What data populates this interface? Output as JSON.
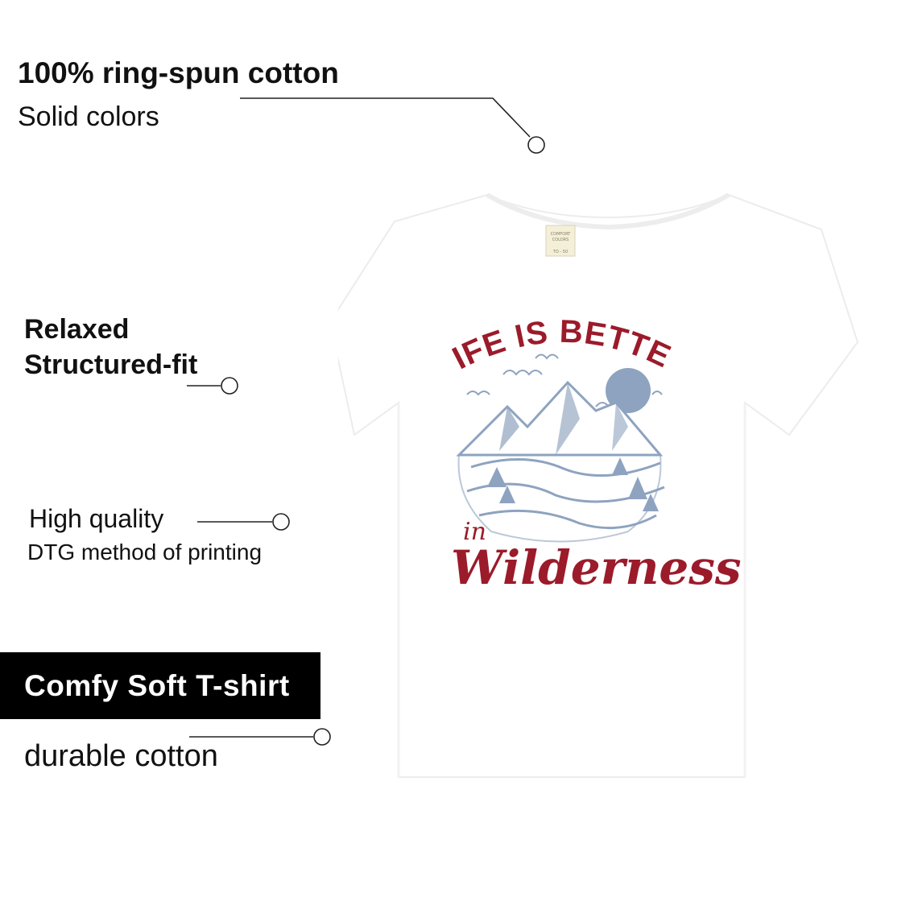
{
  "features": {
    "cotton": {
      "title": "100% ring-spun cotton",
      "subtitle": "Solid colors"
    },
    "fit": {
      "line1": "Relaxed",
      "line2": "Structured-fit"
    },
    "print": {
      "line1": "High quality",
      "line2": "DTG method of printing"
    },
    "banner": {
      "label": "Comfy Soft T-shirt"
    },
    "durable": {
      "label": "durable cotton"
    }
  },
  "shirt": {
    "tag_line1": "COMFORT",
    "tag_line2": "COLORS",
    "tag_line3": "TO - 50",
    "design_headline": "LIFE IS BETTER",
    "design_small_word": "in",
    "design_script_word": "Wilderness"
  },
  "colors": {
    "accent_red": "#9b1b2a",
    "mountain_blue": "#8ea3bf",
    "shirt_white": "#ffffff"
  }
}
